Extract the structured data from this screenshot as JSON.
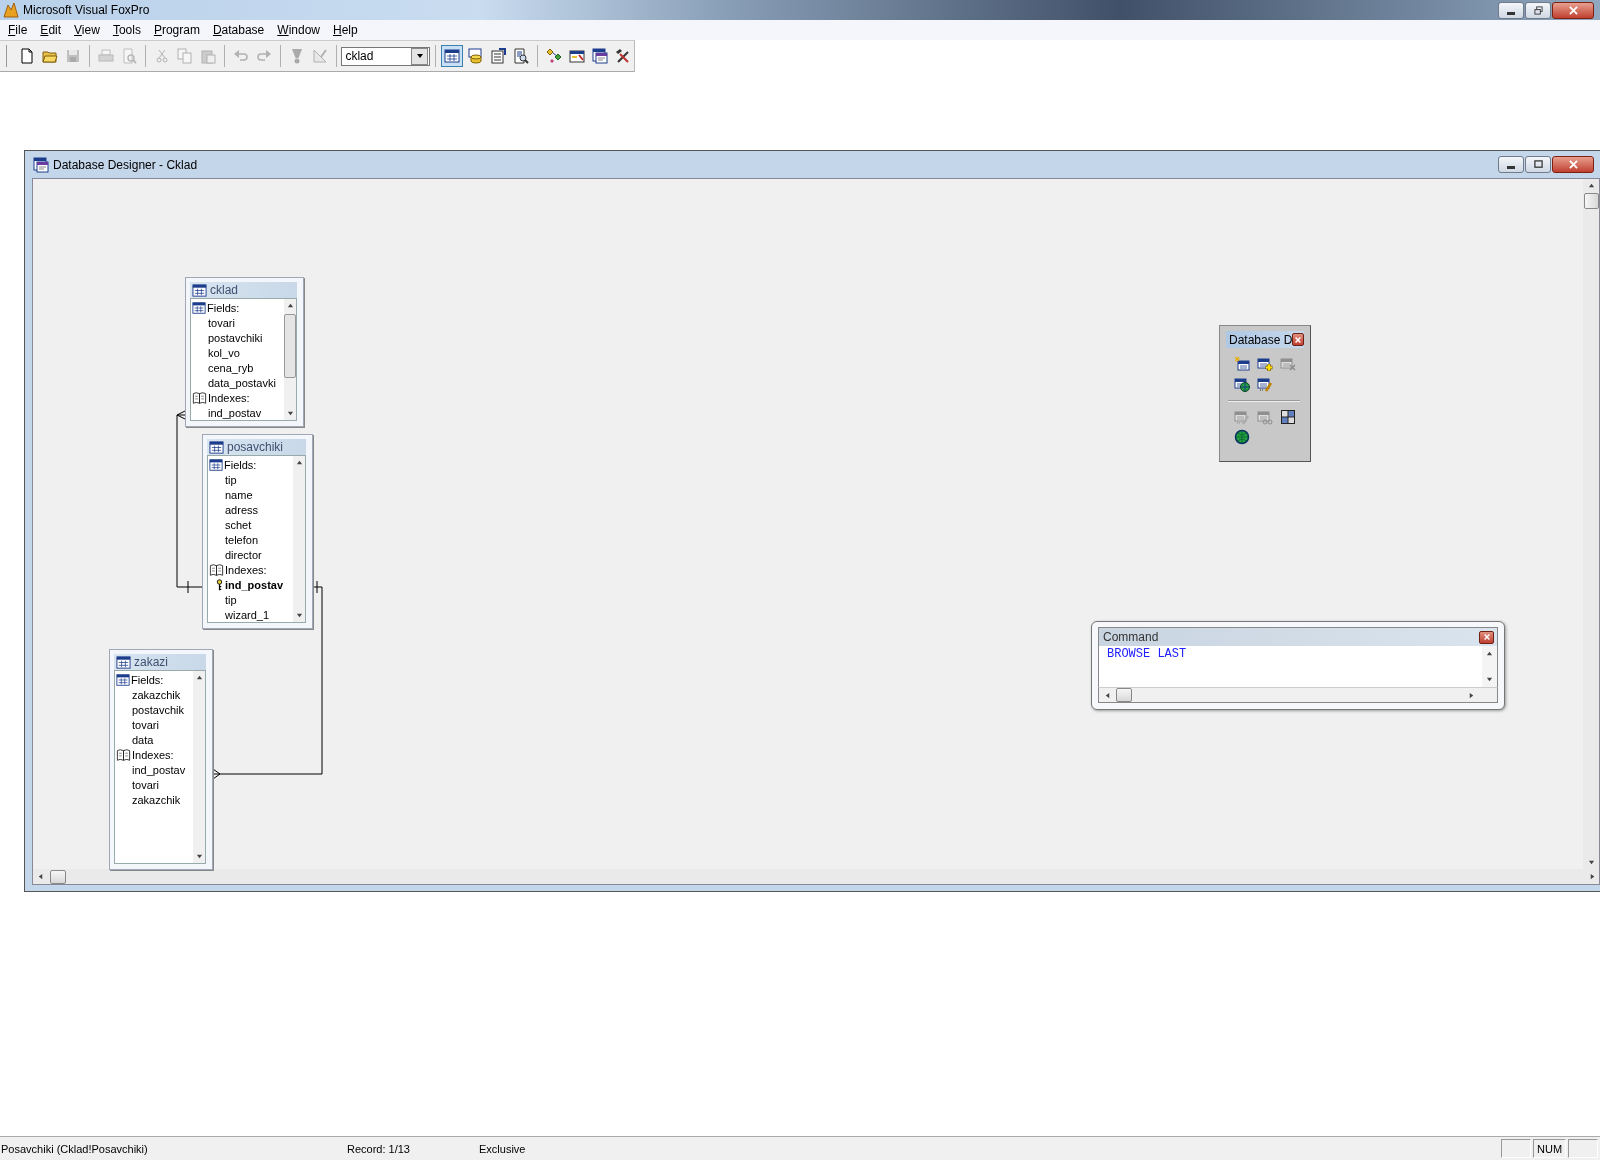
{
  "app": {
    "title": "Microsoft Visual FoxPro"
  },
  "menu": [
    {
      "label": "File"
    },
    {
      "label": "Edit"
    },
    {
      "label": "View"
    },
    {
      "label": "Tools"
    },
    {
      "label": "Program"
    },
    {
      "label": "Database"
    },
    {
      "label": "Window"
    },
    {
      "label": "Help"
    }
  ],
  "toolbar": {
    "items": [
      {
        "kind": "button",
        "disabled": false,
        "selected": false
      },
      {
        "kind": "button",
        "disabled": false,
        "selected": false
      },
      {
        "kind": "button",
        "disabled": true,
        "selected": false
      },
      {
        "kind": "separator"
      },
      {
        "kind": "button",
        "disabled": true,
        "selected": false
      },
      {
        "kind": "button",
        "disabled": true,
        "selected": false
      },
      {
        "kind": "separator"
      },
      {
        "kind": "button",
        "disabled": true,
        "selected": false
      },
      {
        "kind": "button",
        "disabled": true,
        "selected": false
      },
      {
        "kind": "button",
        "disabled": true,
        "selected": false
      },
      {
        "kind": "separator"
      },
      {
        "kind": "button",
        "disabled": true,
        "selected": false
      },
      {
        "kind": "button",
        "disabled": true,
        "selected": false
      },
      {
        "kind": "separator"
      },
      {
        "kind": "button",
        "disabled": true,
        "selected": false
      },
      {
        "kind": "button",
        "disabled": true,
        "selected": false
      },
      {
        "kind": "separator"
      },
      {
        "kind": "combo",
        "value": "cklad"
      },
      {
        "kind": "separator"
      },
      {
        "kind": "button",
        "disabled": false,
        "selected": true
      },
      {
        "kind": "button",
        "disabled": false,
        "selected": false
      },
      {
        "kind": "button",
        "disabled": false,
        "selected": false
      },
      {
        "kind": "button",
        "disabled": false,
        "selected": false
      },
      {
        "kind": "separator"
      },
      {
        "kind": "button",
        "disabled": false,
        "selected": false
      },
      {
        "kind": "button",
        "disabled": false,
        "selected": false
      },
      {
        "kind": "button",
        "disabled": false,
        "selected": false
      },
      {
        "kind": "button",
        "disabled": false,
        "selected": false
      }
    ]
  },
  "designer": {
    "title": "Database Designer - Cklad",
    "tables": [
      {
        "name": "cklad",
        "sections": [
          {
            "kind": "fields",
            "label": "Fields:",
            "items": [
              {
                "text": "tovari"
              },
              {
                "text": "postavchiki"
              },
              {
                "text": "kol_vo"
              },
              {
                "text": "cena_ryb"
              },
              {
                "text": "data_postavki"
              }
            ]
          },
          {
            "kind": "indexes",
            "label": "Indexes:",
            "items": [
              {
                "text": "ind_postav",
                "primary": false
              }
            ]
          }
        ]
      },
      {
        "name": "posavchiki",
        "sections": [
          {
            "kind": "fields",
            "label": "Fields:",
            "items": [
              {
                "text": "tip"
              },
              {
                "text": "name"
              },
              {
                "text": "adress"
              },
              {
                "text": "schet"
              },
              {
                "text": "telefon"
              },
              {
                "text": "director"
              }
            ]
          },
          {
            "kind": "indexes",
            "label": "Indexes:",
            "items": [
              {
                "text": "ind_postav",
                "primary": true
              },
              {
                "text": "tip",
                "primary": false
              },
              {
                "text": "wizard_1",
                "primary": false
              }
            ]
          }
        ]
      },
      {
        "name": "zakazi",
        "sections": [
          {
            "kind": "fields",
            "label": "Fields:",
            "items": [
              {
                "text": "zakazchik"
              },
              {
                "text": "postavchik"
              },
              {
                "text": "tovari"
              },
              {
                "text": "data"
              }
            ]
          },
          {
            "kind": "indexes",
            "label": "Indexes:",
            "items": [
              {
                "text": "ind_postav",
                "primary": false
              },
              {
                "text": "tovari",
                "primary": false
              },
              {
                "text": "zakazchik",
                "primary": false
              }
            ]
          }
        ]
      }
    ],
    "toolbox": {
      "title": "Database D",
      "buttons": [
        {
          "disabled": false
        },
        {
          "disabled": false
        },
        {
          "disabled": true
        },
        {
          "disabled": false
        },
        {
          "disabled": false
        },
        {
          "disabled": true
        },
        {
          "disabled": true
        },
        {
          "disabled": false
        },
        {
          "disabled": false
        }
      ]
    },
    "command": {
      "title": "Command",
      "text": "BROWSE LAST"
    }
  },
  "status_bar": {
    "panes": [
      "Posavchiki (Cklad!Posavchiki)",
      "Record: 1/13",
      "Exclusive"
    ],
    "num_lock": {
      "label": "NUM"
    }
  }
}
